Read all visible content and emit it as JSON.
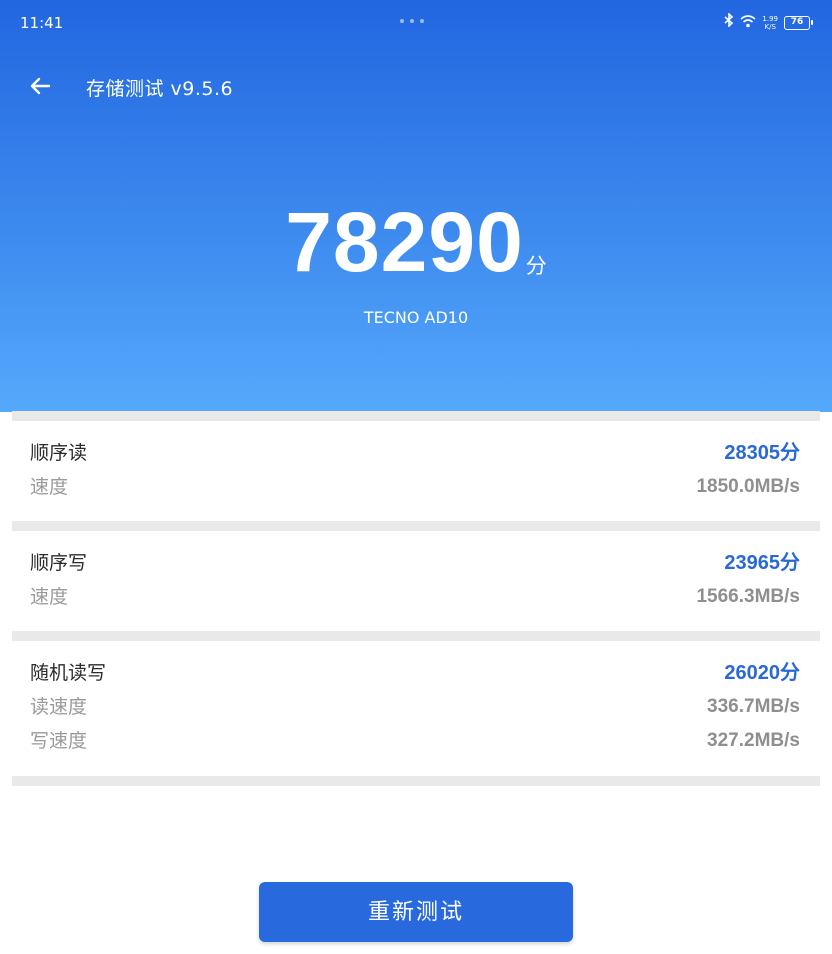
{
  "status_bar": {
    "time": "11:41",
    "net_speed_value": "1.99",
    "net_speed_unit": "K/S",
    "battery": "76",
    "icons": [
      "bluetooth-icon",
      "wifi-icon",
      "battery-icon"
    ]
  },
  "app_bar": {
    "title": "存储测试 v9.5.6",
    "back_icon": "arrow-left-icon"
  },
  "summary": {
    "score": "78290",
    "score_unit": "分",
    "device": "TECNO AD10"
  },
  "results": [
    {
      "name": "顺序读",
      "score": "28305分",
      "details": [
        {
          "label": "速度",
          "value": "1850.0MB/s"
        }
      ]
    },
    {
      "name": "顺序写",
      "score": "23965分",
      "details": [
        {
          "label": "速度",
          "value": "1566.3MB/s"
        }
      ]
    },
    {
      "name": "随机读写",
      "score": "26020分",
      "details": [
        {
          "label": "读速度",
          "value": "336.7MB/s"
        },
        {
          "label": "写速度",
          "value": "327.2MB/s"
        }
      ]
    }
  ],
  "retest_button": "重新测试",
  "colors": {
    "header_gradient_top": "#2266e0",
    "header_gradient_bottom": "#55a9fb",
    "score_accent": "#2869d4",
    "button": "#2869dd"
  }
}
